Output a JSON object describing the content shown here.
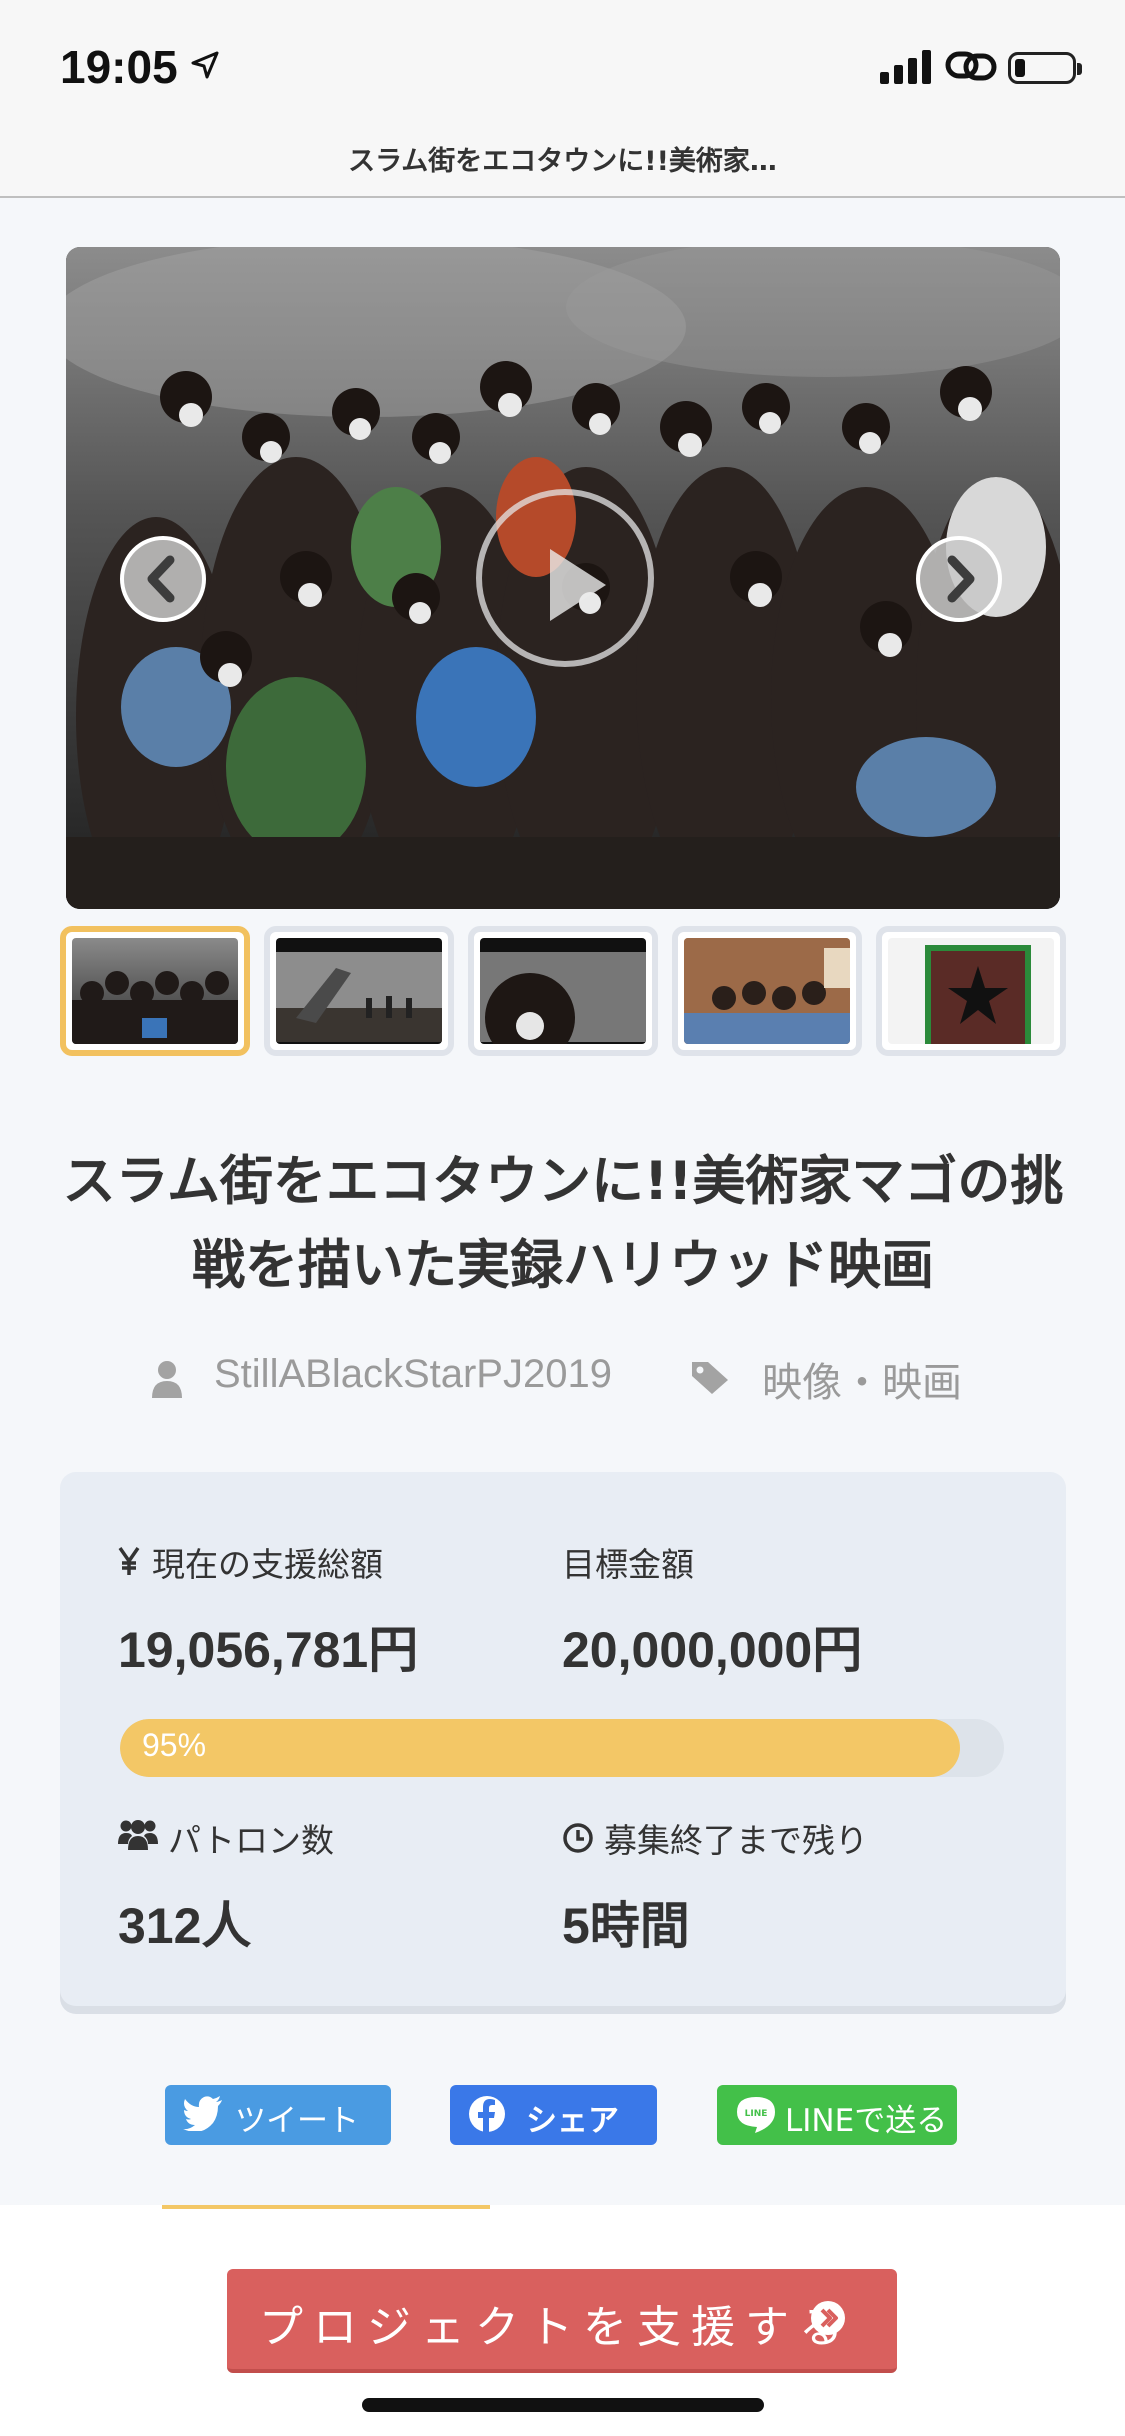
{
  "status_bar": {
    "time": "19:05"
  },
  "nav": {
    "title": "スラム街をエコタウンに!!美術家…"
  },
  "hero": {
    "thumbnail_count": 5,
    "active_thumbnail": 1
  },
  "project": {
    "title": "スラム街をエコタウンに!!美術家マゴの挑戦を描いた実録ハリウッド映画",
    "owner": "StillABlackStarPJ2019",
    "category": "映像・映画"
  },
  "stats": {
    "current_label": "現在の支援総額",
    "current_value": "19,056,781円",
    "goal_label": "目標金額",
    "goal_value": "20,000,000円",
    "progress_percent": 95,
    "progress_text": "95%",
    "patrons_label": "パトロン数",
    "patrons_value": "312人",
    "remaining_label": "募集終了まで残り",
    "remaining_value": "5時間"
  },
  "share": {
    "tweet": "ツイート",
    "facebook": "シェア",
    "line": "LINEで送る"
  },
  "cta": {
    "label": "プロジェクトを支援する"
  },
  "colors": {
    "accent": "#f3c766",
    "cta": "#d9605e",
    "twitter": "#4a9be2",
    "facebook": "#3a78e8",
    "line": "#43c049"
  }
}
